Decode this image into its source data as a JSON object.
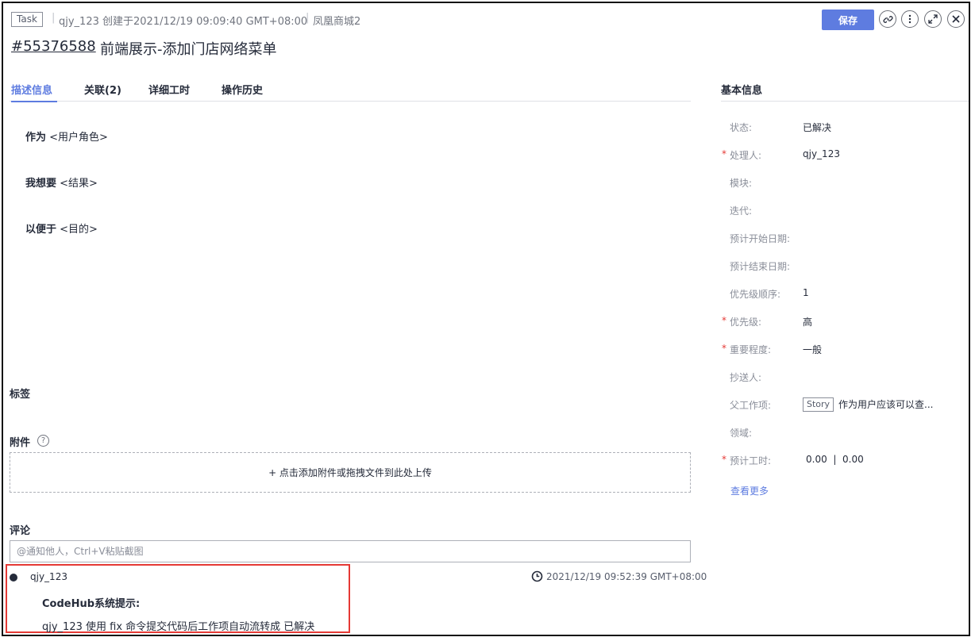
{
  "header": {
    "type_tag": "Task",
    "creator_meta": "qjy_123 创建于2021/12/19 09:09:40 GMT+08:00",
    "project": "凤凰商城2",
    "issue_id": "#55376588",
    "issue_title": "前端展示-添加门店网络菜单",
    "save_label": "保存",
    "icons": [
      "link-icon",
      "more-icon",
      "expand-icon",
      "close-icon"
    ]
  },
  "tabs": [
    {
      "label": "描述信息",
      "active": true
    },
    {
      "label": "关联(2)",
      "active": false
    },
    {
      "label": "详细工时",
      "active": false
    },
    {
      "label": "操作历史",
      "active": false
    }
  ],
  "description": {
    "as_label": "作为",
    "as_value": "<用户角色>",
    "want_label": "我想要",
    "want_value": "<结果>",
    "so_label": "以便于",
    "so_value": "<目的>"
  },
  "tags_section": {
    "title": "标签"
  },
  "attachments": {
    "title": "附件",
    "help": "?",
    "upload_label": "+ 点击添加附件或拖拽文件到此处上传"
  },
  "comments": {
    "title": "评论",
    "placeholder": "@通知他人，Ctrl+V粘贴截图",
    "items": [
      {
        "user": "qjy_123",
        "time": "2021/12/19 09:52:39 GMT+08:00",
        "system_title": "CodeHub系统提示:",
        "message": "qjy_123 使用 fix 命令提交代码后工作项自动流转成 已解决"
      }
    ]
  },
  "basic_info": {
    "title": "基本信息",
    "fields": [
      {
        "label": "状态:",
        "value": "已解决",
        "required": false
      },
      {
        "label": "处理人:",
        "value": "qjy_123",
        "required": true
      },
      {
        "label": "模块:",
        "value": "",
        "required": false
      },
      {
        "label": "迭代:",
        "value": "",
        "required": false
      },
      {
        "label": "预计开始日期:",
        "value": "",
        "required": false
      },
      {
        "label": "预计结束日期:",
        "value": "",
        "required": false
      },
      {
        "label": "优先级顺序:",
        "value": "1",
        "required": false
      },
      {
        "label": "优先级:",
        "value": "高",
        "required": true
      },
      {
        "label": "重要程度:",
        "value": "一般",
        "required": true
      },
      {
        "label": "抄送人:",
        "value": "",
        "required": false
      },
      {
        "label": "父工作项:",
        "value": "作为用户应该可以查...",
        "tag": "Story",
        "required": false
      },
      {
        "label": "领域:",
        "value": "",
        "required": false
      },
      {
        "label": "预计工时:",
        "value": "0.00  |  0.00",
        "required": true
      }
    ],
    "view_more": "查看更多",
    "required_mark": "*"
  },
  "colors": {
    "accent": "#5e7ce0",
    "highlight_box": "#e53935"
  }
}
